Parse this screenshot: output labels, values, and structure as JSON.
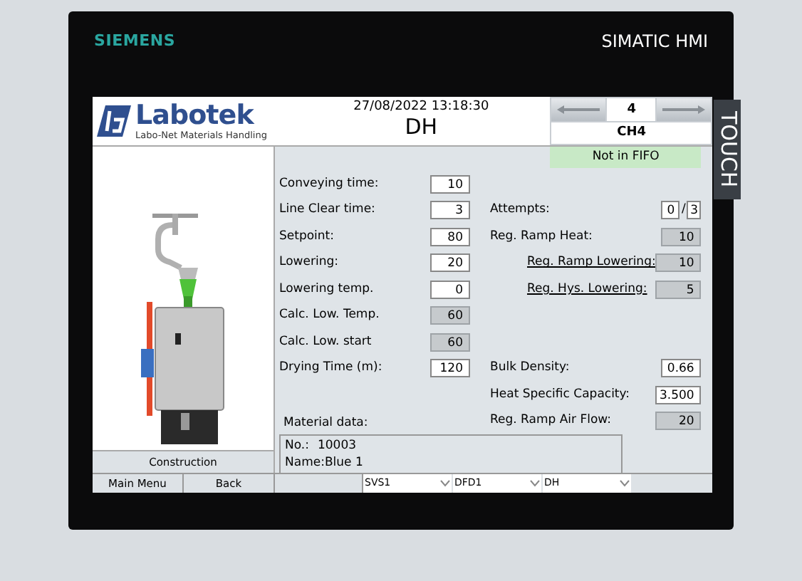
{
  "device": {
    "brand": "SIEMENS",
    "model": "SIMATIC HMI",
    "touch_label": "TOUCH"
  },
  "header": {
    "logo_text": "Labotek",
    "logo_subtitle": "Labo-Net Materials Handling",
    "datetime": "27/08/2022 13:18:30",
    "title": "DH",
    "nav": {
      "number": "4",
      "channel": "CH4"
    }
  },
  "status": "Not in FIFO",
  "picture": {
    "caption": "Construction"
  },
  "rows": [
    {
      "left": {
        "label": "Conveying time:",
        "value": "10",
        "kind": "input"
      }
    },
    {
      "left": {
        "label": "Line Clear time:",
        "value": "3",
        "kind": "input"
      },
      "right": {
        "label": "Attempts:",
        "kind": "pair",
        "values": [
          "0",
          "3"
        ],
        "separator": "/"
      }
    },
    {
      "left": {
        "label": "Setpoint:",
        "value": "80",
        "kind": "input"
      },
      "right": {
        "label": "Reg. Ramp Heat:",
        "value": "10",
        "kind": "readonly",
        "link": false
      }
    },
    {
      "left": {
        "label": "Lowering:",
        "value": "20",
        "kind": "input"
      },
      "right": {
        "label": "Reg. Ramp Lowering:",
        "value": "10",
        "kind": "readonly",
        "link": true
      }
    },
    {
      "left": {
        "label": "Lowering temp.",
        "value": "0",
        "kind": "input"
      },
      "right": {
        "label": "Reg. Hys. Lowering:",
        "value": "5",
        "kind": "readonly",
        "link": true
      }
    },
    {
      "left": {
        "label": "Calc. Low. Temp.",
        "value": "60",
        "kind": "readonly"
      }
    },
    {
      "left": {
        "label": "Calc. Low. start",
        "value": "60",
        "kind": "readonly"
      }
    },
    {
      "left": {
        "label": "Drying Time (m):",
        "value": "120",
        "kind": "input"
      },
      "right": {
        "label": "Bulk Density:",
        "value": "0.66",
        "kind": "input",
        "link": false
      }
    },
    {
      "right": {
        "label": "Heat Specific Capacity:",
        "value": "3.500",
        "kind": "input",
        "link": false
      }
    },
    {
      "left": {
        "label": "Material data:",
        "kind": "heading"
      },
      "right": {
        "label": "Reg. Ramp Air Flow:",
        "value": "20",
        "kind": "readonly",
        "link": false
      }
    }
  ],
  "material": {
    "number_label": "No.:",
    "number": "10003",
    "name": "Name:Blue 1"
  },
  "buttons": [
    "Main Menu",
    "Back"
  ],
  "dropdowns": [
    "SVS1",
    "DFD1",
    "DH"
  ]
}
